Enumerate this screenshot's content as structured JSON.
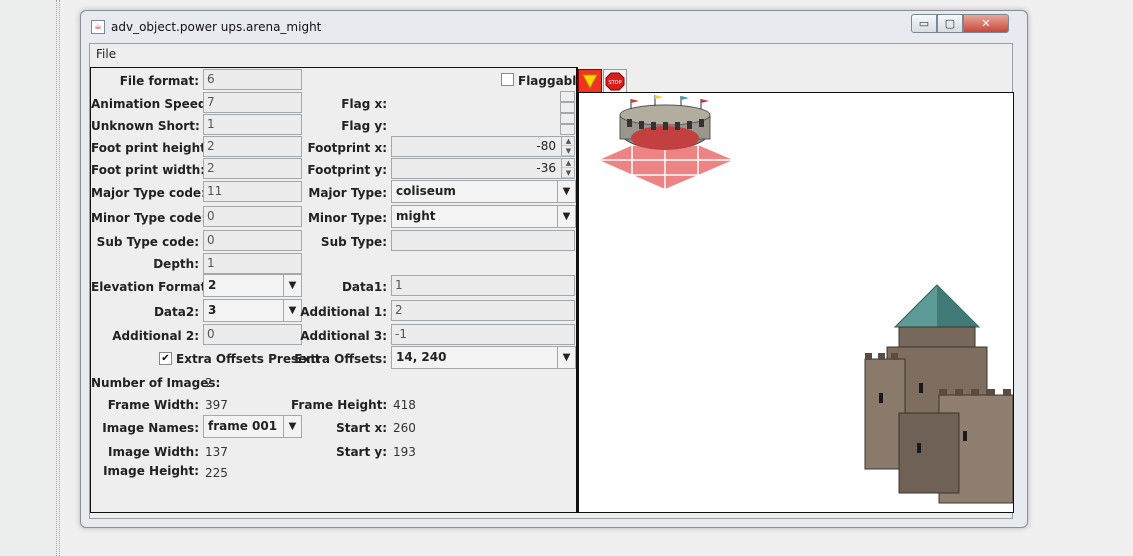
{
  "window": {
    "title": "adv_object.power ups.arena_might",
    "minimize": "▭",
    "maximize": "▢",
    "close": "✕"
  },
  "menu": {
    "file": "File"
  },
  "fields": {
    "file_format": {
      "label": "File format:",
      "value": "6"
    },
    "animation_speed": {
      "label": "Animation Speed:",
      "value": "7"
    },
    "unknown_short": {
      "label": "Unknown Short:",
      "value": "1"
    },
    "foot_print_height": {
      "label": "Foot print height:",
      "value": "2"
    },
    "foot_print_width": {
      "label": "Foot print width:",
      "value": "2"
    },
    "major_type_code": {
      "label": "Major Type code:",
      "value": "11"
    },
    "minor_type_code": {
      "label": "Minor Type code:",
      "value": "0"
    },
    "sub_type_code": {
      "label": "Sub Type code:",
      "value": "0"
    },
    "depth": {
      "label": "Depth:",
      "value": "1"
    },
    "elevation_format": {
      "label": "Elevation Format:",
      "value": "2"
    },
    "data2": {
      "label": "Data2:",
      "value": "3"
    },
    "additional2": {
      "label": "Additional 2:",
      "value": "0"
    },
    "flaggable": {
      "label": "Flaggable"
    },
    "flag_x": {
      "label": "Flag x:"
    },
    "flag_y": {
      "label": "Flag y:"
    },
    "footprint_x": {
      "label": "Footprint x:",
      "value": "-80"
    },
    "footprint_y": {
      "label": "Footprint y:",
      "value": "-36"
    },
    "major_type": {
      "label": "Major Type:",
      "value": "coliseum"
    },
    "minor_type": {
      "label": "Minor Type:",
      "value": "might"
    },
    "sub_type": {
      "label": "Sub Type:",
      "value": ""
    },
    "data1": {
      "label": "Data1:",
      "value": "1"
    },
    "additional1": {
      "label": "Additional 1:",
      "value": "2"
    },
    "additional3": {
      "label": "Additional 3:",
      "value": "-1"
    },
    "extra_offsets_present": {
      "label": "Extra Offsets Present",
      "check": "✔"
    },
    "extra_offsets": {
      "label": "Extra Offsets:",
      "value": "14, 240"
    }
  },
  "info": {
    "number_of_images": {
      "label": "Number of Images:",
      "value": "2"
    },
    "frame_width": {
      "label": "Frame Width:",
      "value": "397"
    },
    "frame_height": {
      "label": "Frame Height:",
      "value": "418"
    },
    "image_names": {
      "label": "Image Names:",
      "value": "frame 001"
    },
    "start_x": {
      "label": "Start x:",
      "value": "260"
    },
    "start_y": {
      "label": "Start y:",
      "value": "193"
    },
    "image_width": {
      "label": "Image Width:",
      "value": "137"
    },
    "image_height": {
      "label": "Image Height:",
      "value": "225"
    }
  },
  "toolbar": {
    "stop_text": "STOP"
  }
}
